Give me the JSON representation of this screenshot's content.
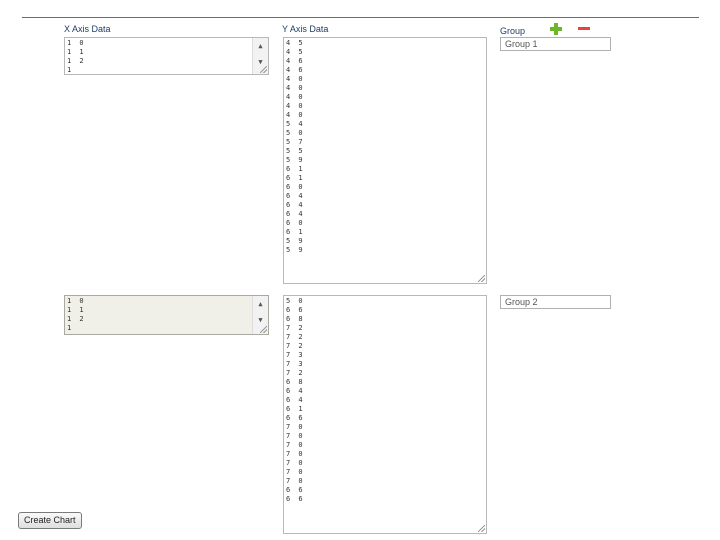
{
  "headers": {
    "x_axis": "X Axis Data",
    "y_axis": "Y Axis Data",
    "group": "Group"
  },
  "icons": {
    "add": "plus-icon",
    "remove": "minus-icon"
  },
  "colors": {
    "header_line": "#2e7fb8",
    "add": "#6ab82a",
    "remove": "#e0463c"
  },
  "group1": {
    "x_lines": [
      "1 0",
      "1 1",
      "1 2",
      "1"
    ],
    "y_lines": [
      "4 5",
      "4 5",
      "4 6",
      "4 6",
      "4 0",
      "4 0",
      "4 0",
      "4 0",
      "4 0",
      "5 4",
      "5 0",
      "5 7",
      "5 5",
      "5 9",
      "6 1",
      "6 1",
      "6 0",
      "6 4",
      "6 4",
      "6 4",
      "6 0",
      "6 1",
      "5 9",
      "5 9"
    ],
    "name": "Group 1"
  },
  "group2": {
    "x_lines": [
      "1 0",
      "1 1",
      "1 2",
      "1"
    ],
    "y_lines": [
      "5 0",
      "6 6",
      "6 8",
      "7 2",
      "7 2",
      "7 2",
      "7 3",
      "7 3",
      "7 2",
      "6 8",
      "6 4",
      "6 4",
      "6 1",
      "6 6",
      "7 0",
      "7 0",
      "7 0",
      "7 0",
      "7 0",
      "7 0",
      "7 0",
      "6 6",
      "6 6"
    ],
    "name": "Group 2"
  },
  "create_button": "Create Chart"
}
